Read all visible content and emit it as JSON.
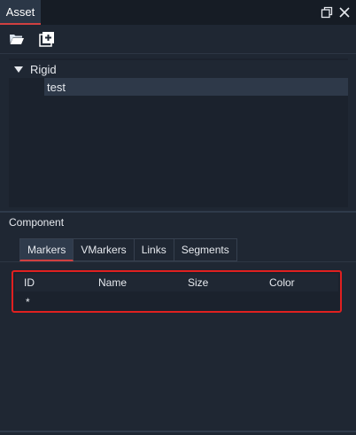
{
  "window": {
    "title": "Asset"
  },
  "toolbar": {
    "open_icon": "folder-open-icon",
    "add_icon": "add-square-icon"
  },
  "tree": {
    "root": {
      "label": "Rigid"
    },
    "children": [
      {
        "label": "test"
      }
    ]
  },
  "component": {
    "label": "Component",
    "tabs": [
      {
        "label": "Markers"
      },
      {
        "label": "VMarkers"
      },
      {
        "label": "Links"
      },
      {
        "label": "Segments"
      }
    ],
    "active_tab": "Markers"
  },
  "table": {
    "columns": [
      "ID",
      "Name",
      "Size",
      "Color"
    ],
    "rows": [
      {
        "id": "*",
        "name": "",
        "size": "",
        "color": ""
      }
    ]
  },
  "colors": {
    "accent": "#d04040",
    "highlight_border": "#e02020",
    "background": "#1f2733"
  }
}
